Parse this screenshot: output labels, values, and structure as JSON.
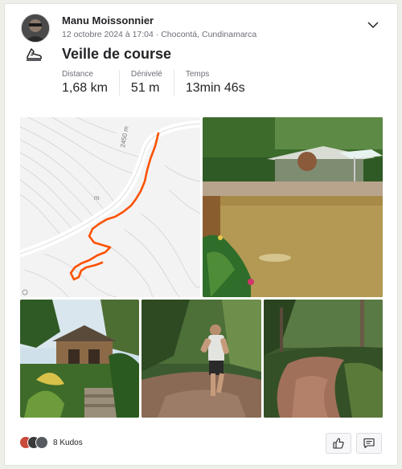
{
  "athlete": {
    "name": "Manu Moissonnier"
  },
  "activity": {
    "datetime": "12 octobre 2024 à 17:04",
    "separator": " · ",
    "location": "Chocontá, Cundinamarca",
    "title": "Veille de course",
    "sport_icon": "running-shoe-icon"
  },
  "stats": [
    {
      "label": "Distance",
      "value": "1,68 km"
    },
    {
      "label": "Dénivelé",
      "value": "51 m"
    },
    {
      "label": "Temps",
      "value": "13min 46s"
    }
  ],
  "map": {
    "contour_label": "2450 m",
    "contour_label_2": "m",
    "route_color": "#fc5200"
  },
  "photos": [
    {
      "name": "pool-photo",
      "subject": "thermal pool with umbrella"
    },
    {
      "name": "cabin-photo",
      "subject": "wooden cabin with palms"
    },
    {
      "name": "runner-photo",
      "subject": "runner on forest trail"
    },
    {
      "name": "trail-photo",
      "subject": "forest dirt path"
    }
  ],
  "footer": {
    "kudos_text": "8 Kudos",
    "kudos_button_icon": "thumbs-up-icon",
    "comment_button_icon": "comment-icon"
  },
  "colors": {
    "accent": "#fc5200",
    "text": "#242428",
    "muted": "#6d6d78"
  }
}
